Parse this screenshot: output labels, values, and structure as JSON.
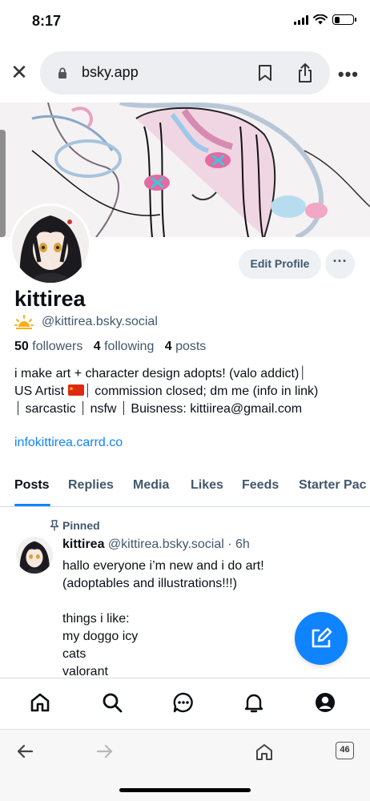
{
  "status_bar": {
    "time": "8:17"
  },
  "browser": {
    "url": "bsky.app",
    "tab_count": "46"
  },
  "profile": {
    "display_name": "kittirea",
    "handle": "@kittirea.bsky.social",
    "followers_count": "50",
    "followers_label": "followers",
    "following_count": "4",
    "following_label": "following",
    "posts_count": "4",
    "posts_label": "posts",
    "bio_line1": "i make art + character design adopts! (valo addict)⏐",
    "bio_line2a": "US Artist ",
    "bio_line2b": "⏐ commission closed; dm me (info in link)",
    "bio_line3": "⏐ sarcastic ⏐ nsfw ⏐ Buisness: kittiirea@gmail.com",
    "link": "infokittirea.carrd.co",
    "edit_button": "Edit Profile"
  },
  "tabs": [
    "Posts",
    "Replies",
    "Media",
    "Likes",
    "Feeds",
    "Starter Pac"
  ],
  "post": {
    "pinned_label": "Pinned",
    "author": "kittirea",
    "handle": "@kittirea.bsky.social",
    "age": "· 6h",
    "text": "hallo everyone i’m new and i do art!\n(adoptables and illustrations!!!)\n\nthings i like:\nmy doggo icy\ncats\nvalorant"
  },
  "colors": {
    "accent": "#1083fe",
    "muted": "#42576c",
    "pill_bg": "#eef1f4"
  }
}
